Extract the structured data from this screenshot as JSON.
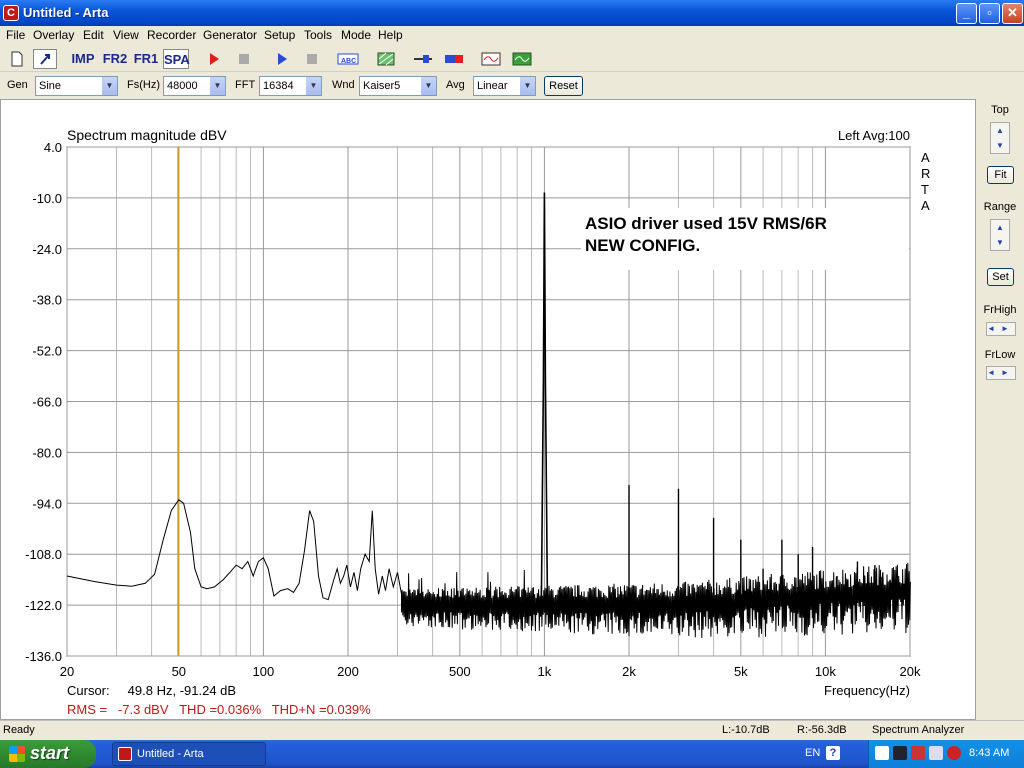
{
  "window": {
    "title": "Untitled - Arta",
    "app_icon": "C"
  },
  "menu": [
    "File",
    "Overlay",
    "Edit",
    "View",
    "Recorder",
    "Generator",
    "Setup",
    "Tools",
    "Mode",
    "Help"
  ],
  "toolbar": {
    "imp": "IMP",
    "fr2": "FR2",
    "fr1": "FR1",
    "spa": "SPA"
  },
  "settings": {
    "gen_label": "Gen",
    "gen_value": "Sine",
    "fs_label": "Fs(Hz)",
    "fs_value": "48000",
    "fft_label": "FFT",
    "fft_value": "16384",
    "wnd_label": "Wnd",
    "wnd_value": "Kaiser5",
    "avg_label": "Avg",
    "avg_value": "Linear",
    "reset_label": "Reset"
  },
  "side": {
    "top_label": "Top",
    "fit_label": "Fit",
    "range_label": "Range",
    "set_label": "Set",
    "frhigh_label": "FrHigh",
    "frlow_label": "FrLow"
  },
  "plot": {
    "title": "Spectrum magnitude dBV",
    "status": "Left  Avg:100",
    "brand": "ARTA",
    "annotation_line1": "ASIO driver used 15V RMS/6R",
    "annotation_line2": "NEW CONFIG.",
    "cursor_text": "Cursor:     49.8 Hz, -91.24 dB",
    "measure_text": "RMS =   -7.3 dBV   THD =0.036%   THD+N =0.039%",
    "xlabel": "Frequency(Hz)"
  },
  "chart_data": {
    "type": "line",
    "title": "Spectrum magnitude dBV",
    "xlabel": "Frequency(Hz)",
    "ylabel": "",
    "x_scale": "log",
    "xlim": [
      20,
      20000
    ],
    "ylim": [
      -136,
      4
    ],
    "y_ticks": [
      "4.0",
      "-10.0",
      "-24.0",
      "-38.0",
      "-52.0",
      "-66.0",
      "-80.0",
      "-94.0",
      "-108.0",
      "-122.0",
      "-136.0"
    ],
    "x_ticks": [
      {
        "v": 20,
        "label": "20"
      },
      {
        "v": 50,
        "label": "50"
      },
      {
        "v": 100,
        "label": "100"
      },
      {
        "v": 200,
        "label": "200"
      },
      {
        "v": 500,
        "label": "500"
      },
      {
        "v": 1000,
        "label": "1k"
      },
      {
        "v": 2000,
        "label": "2k"
      },
      {
        "v": 5000,
        "label": "5k"
      },
      {
        "v": 10000,
        "label": "10k"
      },
      {
        "v": 20000,
        "label": "20k"
      }
    ],
    "grid": true,
    "cursor_freq": 49.8,
    "fundamental": {
      "freq": 1000,
      "level": -8.5
    },
    "harmonics": [
      {
        "freq": 2000,
        "level": -89
      },
      {
        "freq": 3000,
        "level": -90
      },
      {
        "freq": 4000,
        "level": -98
      },
      {
        "freq": 5000,
        "level": -104
      },
      {
        "freq": 6000,
        "level": -112
      },
      {
        "freq": 7000,
        "level": -104
      },
      {
        "freq": 8000,
        "level": -108
      },
      {
        "freq": 9000,
        "level": -106
      },
      {
        "freq": 10000,
        "level": -118
      },
      {
        "freq": 11000,
        "level": -114
      },
      {
        "freq": 12000,
        "level": -115
      },
      {
        "freq": 13000,
        "level": -110
      },
      {
        "freq": 14000,
        "level": -116
      },
      {
        "freq": 15000,
        "level": -111
      },
      {
        "freq": 16000,
        "level": -113
      },
      {
        "freq": 17000,
        "level": -115
      }
    ],
    "low_freq_series": [
      [
        20,
        -114
      ],
      [
        25,
        -115.5
      ],
      [
        30,
        -116.5
      ],
      [
        34,
        -116.8
      ],
      [
        38,
        -116
      ],
      [
        41,
        -113.5
      ],
      [
        44,
        -104
      ],
      [
        47,
        -96
      ],
      [
        50,
        -93
      ],
      [
        52,
        -94
      ],
      [
        55,
        -102
      ],
      [
        57,
        -112
      ],
      [
        60,
        -117
      ],
      [
        63,
        -117.5
      ],
      [
        67,
        -117
      ],
      [
        72,
        -115
      ],
      [
        76,
        -113
      ],
      [
        80,
        -111
      ],
      [
        84,
        -112
      ],
      [
        88,
        -110
      ],
      [
        92,
        -114
      ],
      [
        96,
        -110
      ],
      [
        100,
        -109
      ],
      [
        104,
        -112
      ],
      [
        109,
        -119.5
      ],
      [
        115,
        -118
      ],
      [
        122,
        -117.5
      ],
      [
        128,
        -118.5
      ],
      [
        134,
        -116
      ],
      [
        140,
        -107
      ],
      [
        146,
        -96
      ],
      [
        151,
        -99
      ],
      [
        157,
        -114
      ],
      [
        163,
        -120
      ],
      [
        170,
        -120.5
      ],
      [
        178,
        -115
      ],
      [
        183,
        -112
      ],
      [
        188,
        -116
      ],
      [
        193,
        -114
      ],
      [
        198,
        -111
      ],
      [
        204,
        -117
      ],
      [
        210,
        -113
      ],
      [
        216,
        -118
      ],
      [
        222,
        -112
      ],
      [
        230,
        -108
      ],
      [
        238,
        -110
      ],
      [
        244,
        -96
      ],
      [
        250,
        -112
      ],
      [
        257,
        -119
      ],
      [
        265,
        -114
      ],
      [
        272,
        -118
      ],
      [
        280,
        -112
      ],
      [
        290,
        -117
      ],
      [
        300,
        -113
      ],
      [
        310,
        -119
      ]
    ],
    "noise_floor_dB": -122,
    "noise_floor_hf_dB": -118
  }
}
